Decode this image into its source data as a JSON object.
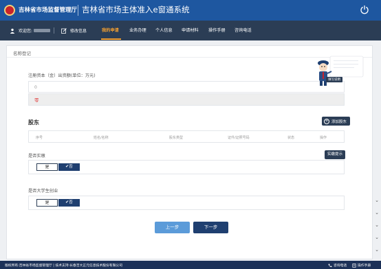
{
  "header": {
    "org_name": "吉林省市场监督管理厅",
    "system_title": "吉林省市场主体准入e窗通系统"
  },
  "nav": {
    "welcome": "欢迎您:",
    "edit_info": "修改信息",
    "items": [
      "我的申请",
      "业务办理",
      "个人信息",
      "申请材料",
      "操作手册",
      "咨询电话"
    ],
    "active_index": 0
  },
  "panel": {
    "title": "名称登记"
  },
  "capital": {
    "label": "注册资本（金）出资额(单位：万元)",
    "value": "0",
    "error_mark": "零"
  },
  "shareholders": {
    "title": "股东",
    "add_label": "添加股东",
    "columns": [
      "序号",
      "姓名/名称",
      "股东类型",
      "证件/证照号码",
      "状态",
      "操作"
    ]
  },
  "paid_in": {
    "label": "是否实缴",
    "example_label": "实缴提示",
    "no_label": "是",
    "yes_label": "✔否"
  },
  "student": {
    "label": "是否大学生创业",
    "no_label": "是",
    "yes_label": "✔否"
  },
  "actions": {
    "prev": "上一步",
    "next": "下一步"
  },
  "mascot": {
    "caption": "填写说明"
  },
  "footer": {
    "left": "版权所有:吉林省市场监督管理厅 | 技术支持:长春吉大正元信息技术股份有限公司",
    "consult": "咨询电话",
    "manual": "操作手册"
  },
  "colors": {
    "header_blue": "#1e57a0",
    "nav_dark": "#2b3d55",
    "active_orange": "#f5a030",
    "primary_dark": "#1f3f70",
    "prev_blue": "#5b9bd9"
  }
}
